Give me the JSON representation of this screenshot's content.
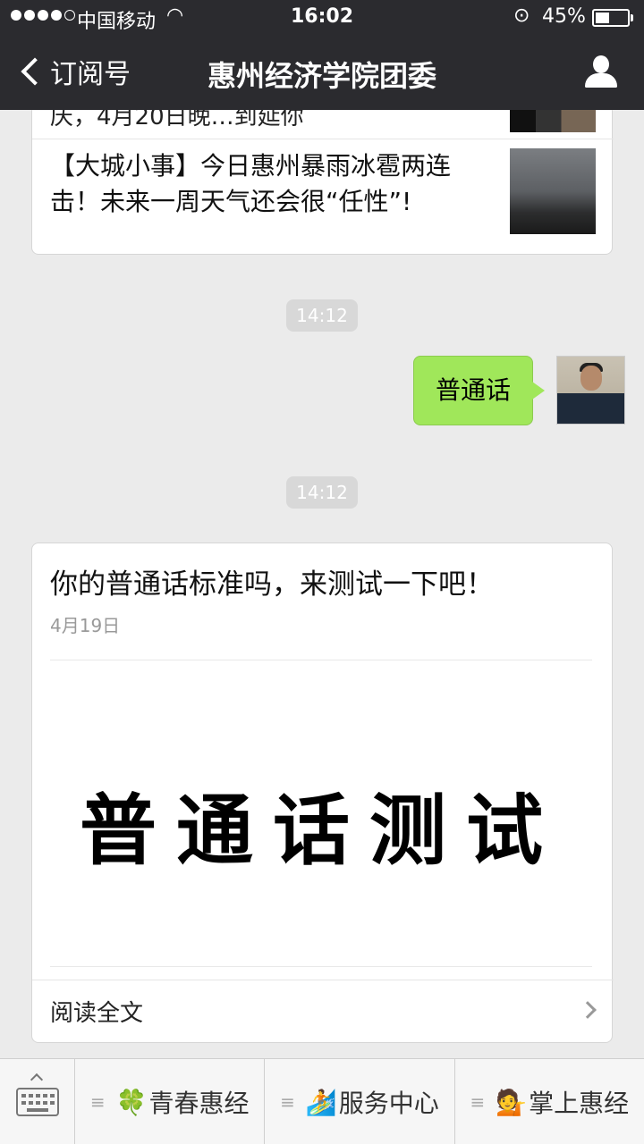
{
  "status_bar": {
    "carrier": "中国移动",
    "time": "16:02",
    "battery_percent_text": "45%",
    "battery_level": 0.45
  },
  "nav": {
    "back_label": "订阅号",
    "title": "惠州经济学院团委"
  },
  "messages": {
    "card1": {
      "partial_text": "庆，4月20日晚…到延你",
      "headline": "【大城小事】今日惠州暴雨冰雹两连击！未来一周天气还会很“任性”!"
    },
    "time1": "14:12",
    "user_bubble": "普通话",
    "time2": "14:12",
    "card2": {
      "title": "你的普通话标准吗，来测试一下吧！",
      "date": "4月19日",
      "cover_text": "普通话测试",
      "read_more": "阅读全文"
    }
  },
  "bottom_menu": {
    "items": [
      {
        "emoji": "🍀",
        "label": "青春惠经"
      },
      {
        "emoji": "🏄",
        "label": "服务中心"
      },
      {
        "emoji": "💁",
        "label": "掌上惠经"
      }
    ]
  }
}
